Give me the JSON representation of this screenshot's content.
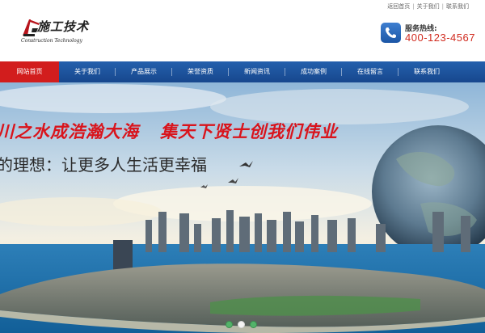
{
  "header": {
    "toplinks": [
      {
        "label": "返回首页"
      },
      {
        "label": "关于我们"
      },
      {
        "label": "联系我们"
      }
    ],
    "logo": {
      "title": "施工技术",
      "subtitle": "Construction Technology"
    },
    "hotline": {
      "label": "服务热线:",
      "number": "400-123-4567",
      "icon": "phone-icon"
    }
  },
  "nav": {
    "active_color": "#d21d1d",
    "bar_color": "#1f56a2",
    "items": [
      {
        "label": "网站首页",
        "active": true
      },
      {
        "label": "关于我们"
      },
      {
        "label": "产品展示"
      },
      {
        "label": "荣誉资质"
      },
      {
        "label": "新闻资讯"
      },
      {
        "label": "成功案例"
      },
      {
        "label": "在线留言"
      },
      {
        "label": "联系我们"
      }
    ]
  },
  "banner": {
    "slogan_part1": "川之水成浩瀚大海",
    "slogan_part2": "集天下贤士创我们伟业",
    "slogan_line2": "的理想：让更多人生活更幸福",
    "slide_count": 3,
    "active_slide": 2
  }
}
